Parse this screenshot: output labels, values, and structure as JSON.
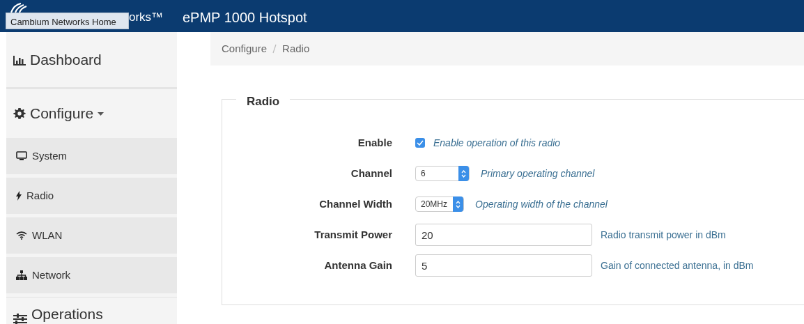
{
  "header": {
    "tooltip": "Cambium Networks Home",
    "brand_visible": "orks™",
    "title": "ePMP 1000 Hotspot"
  },
  "sidebar": {
    "items": [
      {
        "label": "Dashboard"
      },
      {
        "label": "Configure",
        "expanded": true,
        "children": [
          {
            "label": "System"
          },
          {
            "label": "Radio"
          },
          {
            "label": "WLAN"
          },
          {
            "label": "Network"
          }
        ]
      },
      {
        "label": "Operations"
      }
    ]
  },
  "breadcrumb": [
    "Configure",
    "Radio"
  ],
  "section": {
    "legend": "Radio",
    "fields": [
      {
        "kind": "checkbox",
        "label": "Enable",
        "checked": true,
        "help": "Enable operation of this radio"
      },
      {
        "kind": "select",
        "label": "Channel",
        "value": "6",
        "help": "Primary operating channel"
      },
      {
        "kind": "select",
        "label": "Channel Width",
        "value": "20MHz",
        "help": "Operating width of the channel"
      },
      {
        "kind": "text",
        "label": "Transmit Power",
        "value": "20",
        "help": "Radio transmit power in dBm"
      },
      {
        "kind": "text",
        "label": "Antenna Gain",
        "value": "5",
        "help": "Gain of connected antenna, in dBm"
      }
    ]
  }
}
